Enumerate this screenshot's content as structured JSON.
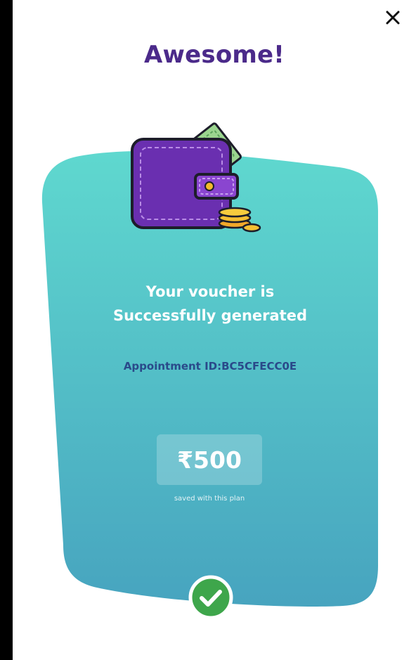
{
  "dialog": {
    "title": "Awesome!",
    "message_line1": "Your voucher is",
    "message_line2": "Successfully generated",
    "appointment_id": "Appointment ID:BC5CFECC0E",
    "amount": "₹500",
    "amount_caption": "saved with this plan"
  },
  "icons": {
    "close": "close-icon",
    "wallet": "wallet-icon",
    "success": "check-circle-icon"
  },
  "colors": {
    "title": "#4b2a8a",
    "card_top": "#5dd6cd",
    "card_bottom": "#48a7bf",
    "wallet": "#6a2fb0",
    "success": "#3ea64b",
    "appointment": "#2a4a8a"
  }
}
